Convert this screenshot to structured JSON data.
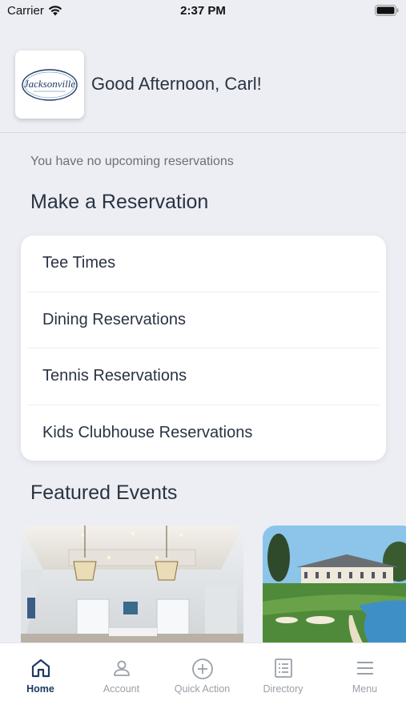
{
  "status_bar": {
    "carrier": "Carrier",
    "time": "2:37 PM",
    "icons": [
      "wifi-icon",
      "battery-icon"
    ]
  },
  "header": {
    "logo_text": "Jacksonville",
    "greeting": "Good Afternoon, Carl!"
  },
  "reservations": {
    "empty_message": "You have no upcoming reservations"
  },
  "make_reservation": {
    "title": "Make a Reservation",
    "items": [
      {
        "label": "Tee Times"
      },
      {
        "label": "Dining Reservations"
      },
      {
        "label": "Tennis Reservations"
      },
      {
        "label": "Kids Clubhouse Reservations"
      }
    ]
  },
  "featured_events": {
    "title": "Featured Events",
    "events": [
      {
        "image": "ballroom-photo"
      },
      {
        "image": "golf-course-photo"
      }
    ]
  },
  "tab_bar": {
    "active": "Home",
    "accent_color": "#1f3a63",
    "inactive_color": "#9aa0a8",
    "tabs": [
      {
        "label": "Home",
        "icon": "home-icon"
      },
      {
        "label": "Account",
        "icon": "account-icon"
      },
      {
        "label": "Quick Action",
        "icon": "plus-circle-icon"
      },
      {
        "label": "Directory",
        "icon": "directory-icon"
      },
      {
        "label": "Menu",
        "icon": "menu-icon"
      }
    ]
  }
}
